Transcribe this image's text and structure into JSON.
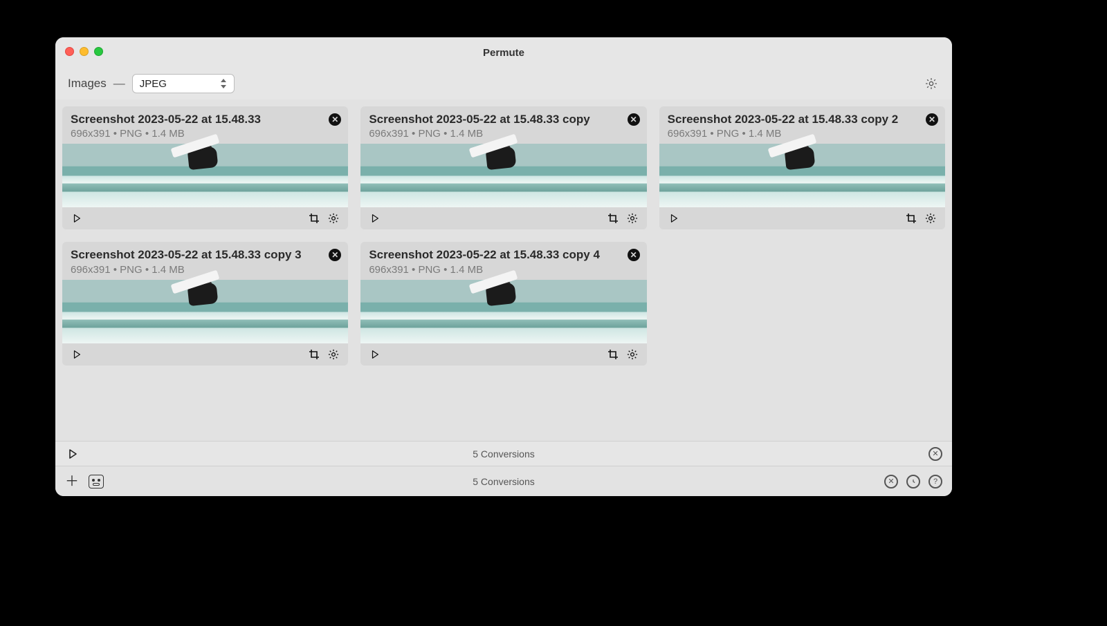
{
  "app": {
    "title": "Permute"
  },
  "toolbar": {
    "category": "Images",
    "dash": "—",
    "format": "JPEG"
  },
  "cards": [
    {
      "title": "Screenshot 2023-05-22 at 15.48.33",
      "meta": "696x391 • PNG • 1.4 MB"
    },
    {
      "title": "Screenshot 2023-05-22 at 15.48.33 copy",
      "meta": "696x391 • PNG • 1.4 MB"
    },
    {
      "title": "Screenshot 2023-05-22 at 15.48.33 copy 2",
      "meta": "696x391 • PNG • 1.4 MB"
    },
    {
      "title": "Screenshot 2023-05-22 at 15.48.33 copy 3",
      "meta": "696x391 • PNG • 1.4 MB"
    },
    {
      "title": "Screenshot 2023-05-22 at 15.48.33 copy 4",
      "meta": "696x391 • PNG • 1.4 MB"
    }
  ],
  "group_status": "5 Conversions",
  "window_status": "5 Conversions"
}
